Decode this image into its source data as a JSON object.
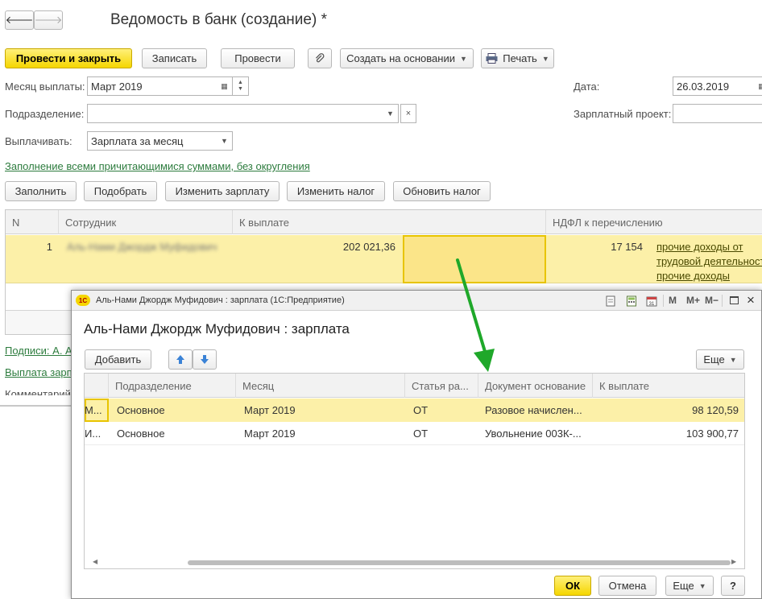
{
  "main": {
    "title": "Ведомость в банк (создание) *",
    "nav": {
      "back": "🡐",
      "forward": "🡒"
    },
    "toolbar": {
      "post_close": "Провести и закрыть",
      "save": "Записать",
      "post": "Провести",
      "create_based": "Создать на основании",
      "print": "Печать"
    },
    "form": {
      "month_label": "Месяц выплаты:",
      "month_value": "Март 2019",
      "date_label": "Дата:",
      "date_value": "26.03.2019",
      "division_label": "Подразделение:",
      "division_value": "",
      "salary_project_label": "Зарплатный проект:",
      "salary_project_value": "",
      "pay_label": "Выплачивать:",
      "pay_value": "Зарплата за месяц"
    },
    "fill_link": "Заполнение всеми причитающимися суммами, без округления",
    "actions": {
      "fill": "Заполнить",
      "select": "Подобрать",
      "change_salary": "Изменить зарплату",
      "change_tax": "Изменить налог",
      "update_tax": "Обновить налог"
    },
    "table": {
      "headers": {
        "n": "N",
        "employee": "Сотрудник",
        "to_pay": "К выплате",
        "ndfl": "НДФЛ к перечислению"
      },
      "row": {
        "n": "1",
        "employee": "Аль-Нами Джордж Муфидович",
        "to_pay": "202 021,36",
        "ndfl": "17 154",
        "ndfl_link1": "прочие доходы от",
        "ndfl_link2": "трудовой деятельности",
        "ndfl_link3": "прочие доходы"
      }
    },
    "signatures_link": "Подписи: А. А",
    "payout_link": "Выплата зарп",
    "comment_label": "Комментарий:"
  },
  "dialog": {
    "window_title": "Аль-Нами Джордж Муфидович : зарплата  (1С:Предприятие)",
    "header": "Аль-Нами Джордж Муфидович : зарплата",
    "logo": "1С",
    "window_buttons": {
      "m": "M",
      "m_plus": "M+",
      "m_minus": "M−"
    },
    "toolbar": {
      "add": "Добавить",
      "more": "Еще"
    },
    "columns": [
      "Подразделение",
      "Месяц",
      "Статья ра...",
      "Документ основание",
      "К выплате"
    ],
    "rows": [
      {
        "first": "М...",
        "division": "Основное",
        "month": "Март 2019",
        "article": "ОТ",
        "doc": "Разовое начислен...",
        "amount": "98 120,59"
      },
      {
        "first": "И...",
        "division": "Основное",
        "month": "Март 2019",
        "article": "ОТ",
        "doc": "Увольнение 003К-...",
        "amount": "103 900,77"
      }
    ],
    "footer": {
      "ok": "ОК",
      "cancel": "Отмена",
      "more": "Еще",
      "help": "?"
    }
  },
  "colors": {
    "accent_yellow": "#f5d600",
    "link_green": "#2d7c3e",
    "selected_row": "#fcf0a8",
    "arrow_green": "#1fa82a"
  }
}
